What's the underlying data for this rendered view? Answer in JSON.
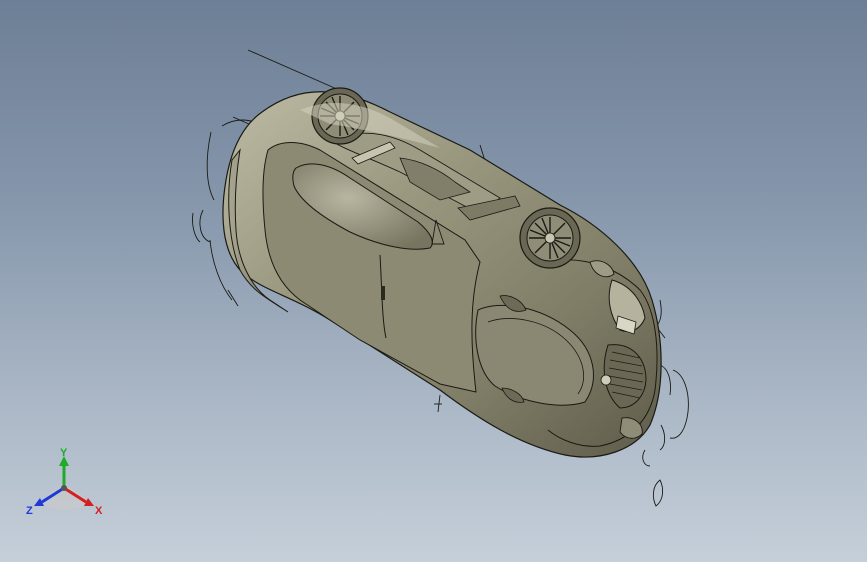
{
  "viewport": {
    "background_top": "#6d7f96",
    "background_bottom": "#c5cfd9"
  },
  "model": {
    "body_color": "#8d8b74",
    "edge_color": "#1a1a14",
    "highlight_color": "#c7c5b0"
  },
  "triad": {
    "x_label": "X",
    "y_label": "Y",
    "z_label": "Z",
    "x_color": "#d42020",
    "y_color": "#1faa2a",
    "z_color": "#2038d8"
  }
}
